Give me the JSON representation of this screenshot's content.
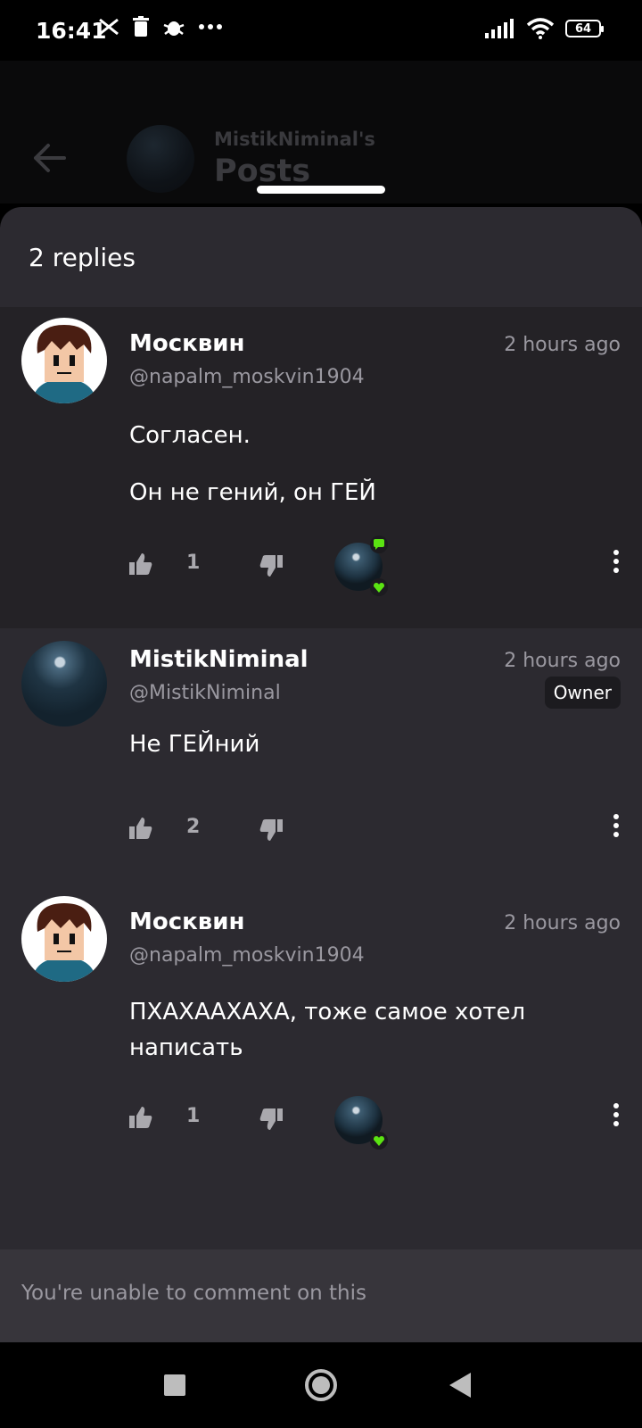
{
  "status_bar": {
    "time": "16:41",
    "battery": "64"
  },
  "header": {
    "subtitle": "MistikNiminal's",
    "title": "Posts"
  },
  "sheet": {
    "replies_label": "2 replies"
  },
  "replies": [
    {
      "name": "Москвин",
      "handle": "@napalm_moskvin1904",
      "time": "2 hours ago",
      "paragraphs": [
        "Согласен.",
        "Он не гений, он ГЕЙ"
      ],
      "likes": "1"
    },
    {
      "name": "MistikNiminal",
      "handle": "@MistikNiminal",
      "time": "2 hours ago",
      "badge": "Owner",
      "paragraphs": [
        "Не ГЕЙний"
      ],
      "likes": "2"
    },
    {
      "name": "Москвин",
      "handle": "@napalm_moskvin1904",
      "time": "2 hours ago",
      "paragraphs": [
        "ПХАХААХАХА, тоже самое хотел написать"
      ],
      "likes": "1"
    }
  ],
  "footer": {
    "comment_disabled": "You're unable to comment on this"
  },
  "colors": {
    "background": "#2c2a30",
    "highlight_row": "#242226",
    "accent_green": "#5be312",
    "muted_text": "#9a98a0"
  }
}
